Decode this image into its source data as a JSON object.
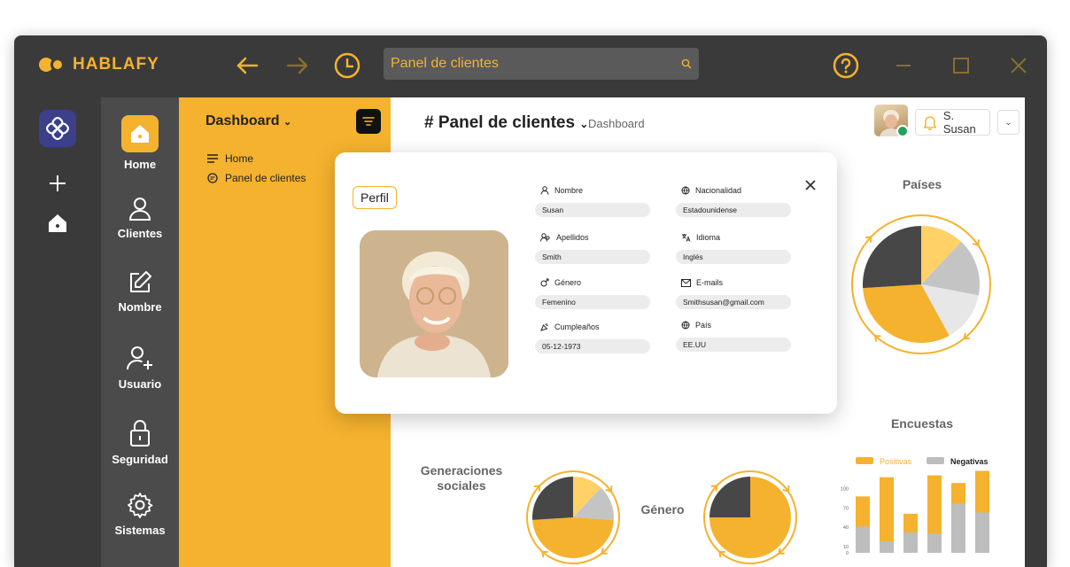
{
  "app": {
    "brand": "HABLAFY"
  },
  "search": {
    "placeholder": "Panel de clientes"
  },
  "nav": {
    "home": "Home",
    "clientes": "Clientes",
    "nombre": "Nombre",
    "usuario": "Usuario",
    "seguridad": "Seguridad",
    "sistemas": "Sistemas"
  },
  "sidebar": {
    "title": "Dashboard",
    "links": [
      "Home",
      "Panel de clientes"
    ]
  },
  "main": {
    "title": "# Panel de clientes",
    "breadcrumb": "Dashboard",
    "user": "S. Susan"
  },
  "profile": {
    "badge": "Perfil",
    "fields": {
      "nombre": {
        "label": "Nombre",
        "value": "Susan"
      },
      "nacionalidad": {
        "label": "Nacionalidad",
        "value": "Estadounidense"
      },
      "apellidos": {
        "label": "Apellidos",
        "value": "Smith"
      },
      "idioma": {
        "label": "Idioma",
        "value": "Inglés"
      },
      "genero": {
        "label": "Género",
        "value": "Femenino"
      },
      "emails": {
        "label": "E-mails",
        "value": "Smithsusan@gmail.com"
      },
      "cumpleanos": {
        "label": "Cumpleaños",
        "value": "05-12-1973"
      },
      "pais": {
        "label": "País",
        "value": "EE.UU"
      }
    }
  },
  "colors": {
    "accent": "#f5b22e",
    "dark": "#3a3a3a",
    "gray": "#bdbdbd",
    "light": "#e6e6e6"
  },
  "chart_data": [
    {
      "type": "pie",
      "title": "Países",
      "slices": [
        {
          "value": 12,
          "color": "#ffd166"
        },
        {
          "value": 16,
          "color": "#c4c4c4"
        },
        {
          "value": 14,
          "color": "#e7e7e7"
        },
        {
          "value": 32,
          "color": "#f5b22e"
        },
        {
          "value": 26,
          "color": "#474747"
        }
      ]
    },
    {
      "type": "pie",
      "title": "Generaciones sociales",
      "slices": [
        {
          "value": 12,
          "color": "#ffd166"
        },
        {
          "value": 14,
          "color": "#c4c4c4"
        },
        {
          "value": 48,
          "color": "#f5b22e"
        },
        {
          "value": 26,
          "color": "#474747"
        }
      ]
    },
    {
      "type": "pie",
      "title": "Género",
      "slices": [
        {
          "value": 75,
          "color": "#f5b22e"
        },
        {
          "value": 25,
          "color": "#474747"
        }
      ]
    },
    {
      "type": "bar",
      "title": "Encuestas",
      "legend": [
        "Positivas",
        "Negativas"
      ],
      "ylim": [
        0,
        130
      ],
      "yticks": [
        0,
        10,
        40,
        70,
        100
      ],
      "series": [
        {
          "name": "Positivas",
          "values": [
            88,
            118,
            61,
            121,
            109,
            128
          ]
        },
        {
          "name": "Negativas",
          "values": [
            41,
            18,
            32,
            30,
            77,
            63
          ]
        }
      ]
    }
  ]
}
